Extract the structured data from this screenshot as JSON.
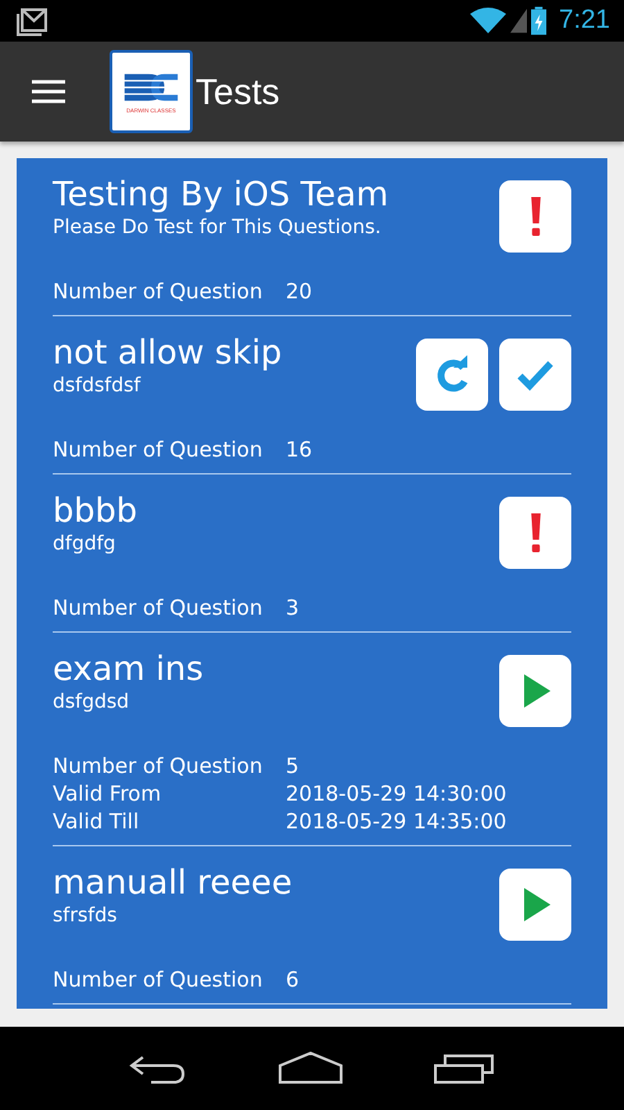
{
  "status_bar": {
    "time": "7:21"
  },
  "app_bar": {
    "logo_text": "DARWIN CLASSES",
    "title": "Tests"
  },
  "tests": [
    {
      "title": "Testing By iOS Team",
      "subtitle": "Please Do Test for This Questions.",
      "details": [
        {
          "label": "Number of Question",
          "value": "20"
        }
      ],
      "actions": [
        {
          "kind": "alert"
        }
      ]
    },
    {
      "title": "not allow skip",
      "subtitle": "dsfdsfdsf",
      "details": [
        {
          "label": "Number of Question",
          "value": "16"
        }
      ],
      "actions": [
        {
          "kind": "retry"
        },
        {
          "kind": "done"
        }
      ]
    },
    {
      "title": "bbbb",
      "subtitle": "dfgdfg",
      "details": [
        {
          "label": "Number of Question",
          "value": "3"
        }
      ],
      "actions": [
        {
          "kind": "alert"
        }
      ]
    },
    {
      "title": "exam ins",
      "subtitle": "dsfgdsd",
      "details": [
        {
          "label": "Number of Question",
          "value": "5"
        },
        {
          "label": "Valid From",
          "value": "2018-05-29 14:30:00"
        },
        {
          "label": "Valid Till",
          "value": "2018-05-29 14:35:00"
        }
      ],
      "actions": [
        {
          "kind": "play"
        }
      ]
    },
    {
      "title": "manuall reeee",
      "subtitle": "sfrsfds",
      "details": [
        {
          "label": "Number of Question",
          "value": "6"
        }
      ],
      "actions": [
        {
          "kind": "play"
        }
      ]
    }
  ]
}
